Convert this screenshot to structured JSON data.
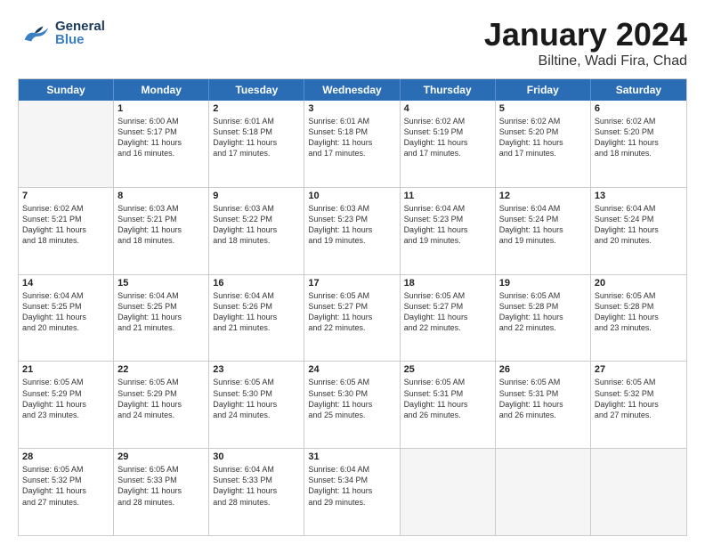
{
  "header": {
    "logo_general": "General",
    "logo_blue": "Blue",
    "title": "January 2024",
    "location": "Biltine, Wadi Fira, Chad"
  },
  "weekdays": [
    "Sunday",
    "Monday",
    "Tuesday",
    "Wednesday",
    "Thursday",
    "Friday",
    "Saturday"
  ],
  "weeks": [
    [
      {
        "day": "",
        "info": ""
      },
      {
        "day": "1",
        "info": "Sunrise: 6:00 AM\nSunset: 5:17 PM\nDaylight: 11 hours\nand 16 minutes."
      },
      {
        "day": "2",
        "info": "Sunrise: 6:01 AM\nSunset: 5:18 PM\nDaylight: 11 hours\nand 17 minutes."
      },
      {
        "day": "3",
        "info": "Sunrise: 6:01 AM\nSunset: 5:18 PM\nDaylight: 11 hours\nand 17 minutes."
      },
      {
        "day": "4",
        "info": "Sunrise: 6:02 AM\nSunset: 5:19 PM\nDaylight: 11 hours\nand 17 minutes."
      },
      {
        "day": "5",
        "info": "Sunrise: 6:02 AM\nSunset: 5:20 PM\nDaylight: 11 hours\nand 17 minutes."
      },
      {
        "day": "6",
        "info": "Sunrise: 6:02 AM\nSunset: 5:20 PM\nDaylight: 11 hours\nand 18 minutes."
      }
    ],
    [
      {
        "day": "7",
        "info": "Sunrise: 6:02 AM\nSunset: 5:21 PM\nDaylight: 11 hours\nand 18 minutes."
      },
      {
        "day": "8",
        "info": "Sunrise: 6:03 AM\nSunset: 5:21 PM\nDaylight: 11 hours\nand 18 minutes."
      },
      {
        "day": "9",
        "info": "Sunrise: 6:03 AM\nSunset: 5:22 PM\nDaylight: 11 hours\nand 18 minutes."
      },
      {
        "day": "10",
        "info": "Sunrise: 6:03 AM\nSunset: 5:23 PM\nDaylight: 11 hours\nand 19 minutes."
      },
      {
        "day": "11",
        "info": "Sunrise: 6:04 AM\nSunset: 5:23 PM\nDaylight: 11 hours\nand 19 minutes."
      },
      {
        "day": "12",
        "info": "Sunrise: 6:04 AM\nSunset: 5:24 PM\nDaylight: 11 hours\nand 19 minutes."
      },
      {
        "day": "13",
        "info": "Sunrise: 6:04 AM\nSunset: 5:24 PM\nDaylight: 11 hours\nand 20 minutes."
      }
    ],
    [
      {
        "day": "14",
        "info": "Sunrise: 6:04 AM\nSunset: 5:25 PM\nDaylight: 11 hours\nand 20 minutes."
      },
      {
        "day": "15",
        "info": "Sunrise: 6:04 AM\nSunset: 5:25 PM\nDaylight: 11 hours\nand 21 minutes."
      },
      {
        "day": "16",
        "info": "Sunrise: 6:04 AM\nSunset: 5:26 PM\nDaylight: 11 hours\nand 21 minutes."
      },
      {
        "day": "17",
        "info": "Sunrise: 6:05 AM\nSunset: 5:27 PM\nDaylight: 11 hours\nand 22 minutes."
      },
      {
        "day": "18",
        "info": "Sunrise: 6:05 AM\nSunset: 5:27 PM\nDaylight: 11 hours\nand 22 minutes."
      },
      {
        "day": "19",
        "info": "Sunrise: 6:05 AM\nSunset: 5:28 PM\nDaylight: 11 hours\nand 22 minutes."
      },
      {
        "day": "20",
        "info": "Sunrise: 6:05 AM\nSunset: 5:28 PM\nDaylight: 11 hours\nand 23 minutes."
      }
    ],
    [
      {
        "day": "21",
        "info": "Sunrise: 6:05 AM\nSunset: 5:29 PM\nDaylight: 11 hours\nand 23 minutes."
      },
      {
        "day": "22",
        "info": "Sunrise: 6:05 AM\nSunset: 5:29 PM\nDaylight: 11 hours\nand 24 minutes."
      },
      {
        "day": "23",
        "info": "Sunrise: 6:05 AM\nSunset: 5:30 PM\nDaylight: 11 hours\nand 24 minutes."
      },
      {
        "day": "24",
        "info": "Sunrise: 6:05 AM\nSunset: 5:30 PM\nDaylight: 11 hours\nand 25 minutes."
      },
      {
        "day": "25",
        "info": "Sunrise: 6:05 AM\nSunset: 5:31 PM\nDaylight: 11 hours\nand 26 minutes."
      },
      {
        "day": "26",
        "info": "Sunrise: 6:05 AM\nSunset: 5:31 PM\nDaylight: 11 hours\nand 26 minutes."
      },
      {
        "day": "27",
        "info": "Sunrise: 6:05 AM\nSunset: 5:32 PM\nDaylight: 11 hours\nand 27 minutes."
      }
    ],
    [
      {
        "day": "28",
        "info": "Sunrise: 6:05 AM\nSunset: 5:32 PM\nDaylight: 11 hours\nand 27 minutes."
      },
      {
        "day": "29",
        "info": "Sunrise: 6:05 AM\nSunset: 5:33 PM\nDaylight: 11 hours\nand 28 minutes."
      },
      {
        "day": "30",
        "info": "Sunrise: 6:04 AM\nSunset: 5:33 PM\nDaylight: 11 hours\nand 28 minutes."
      },
      {
        "day": "31",
        "info": "Sunrise: 6:04 AM\nSunset: 5:34 PM\nDaylight: 11 hours\nand 29 minutes."
      },
      {
        "day": "",
        "info": ""
      },
      {
        "day": "",
        "info": ""
      },
      {
        "day": "",
        "info": ""
      }
    ]
  ]
}
